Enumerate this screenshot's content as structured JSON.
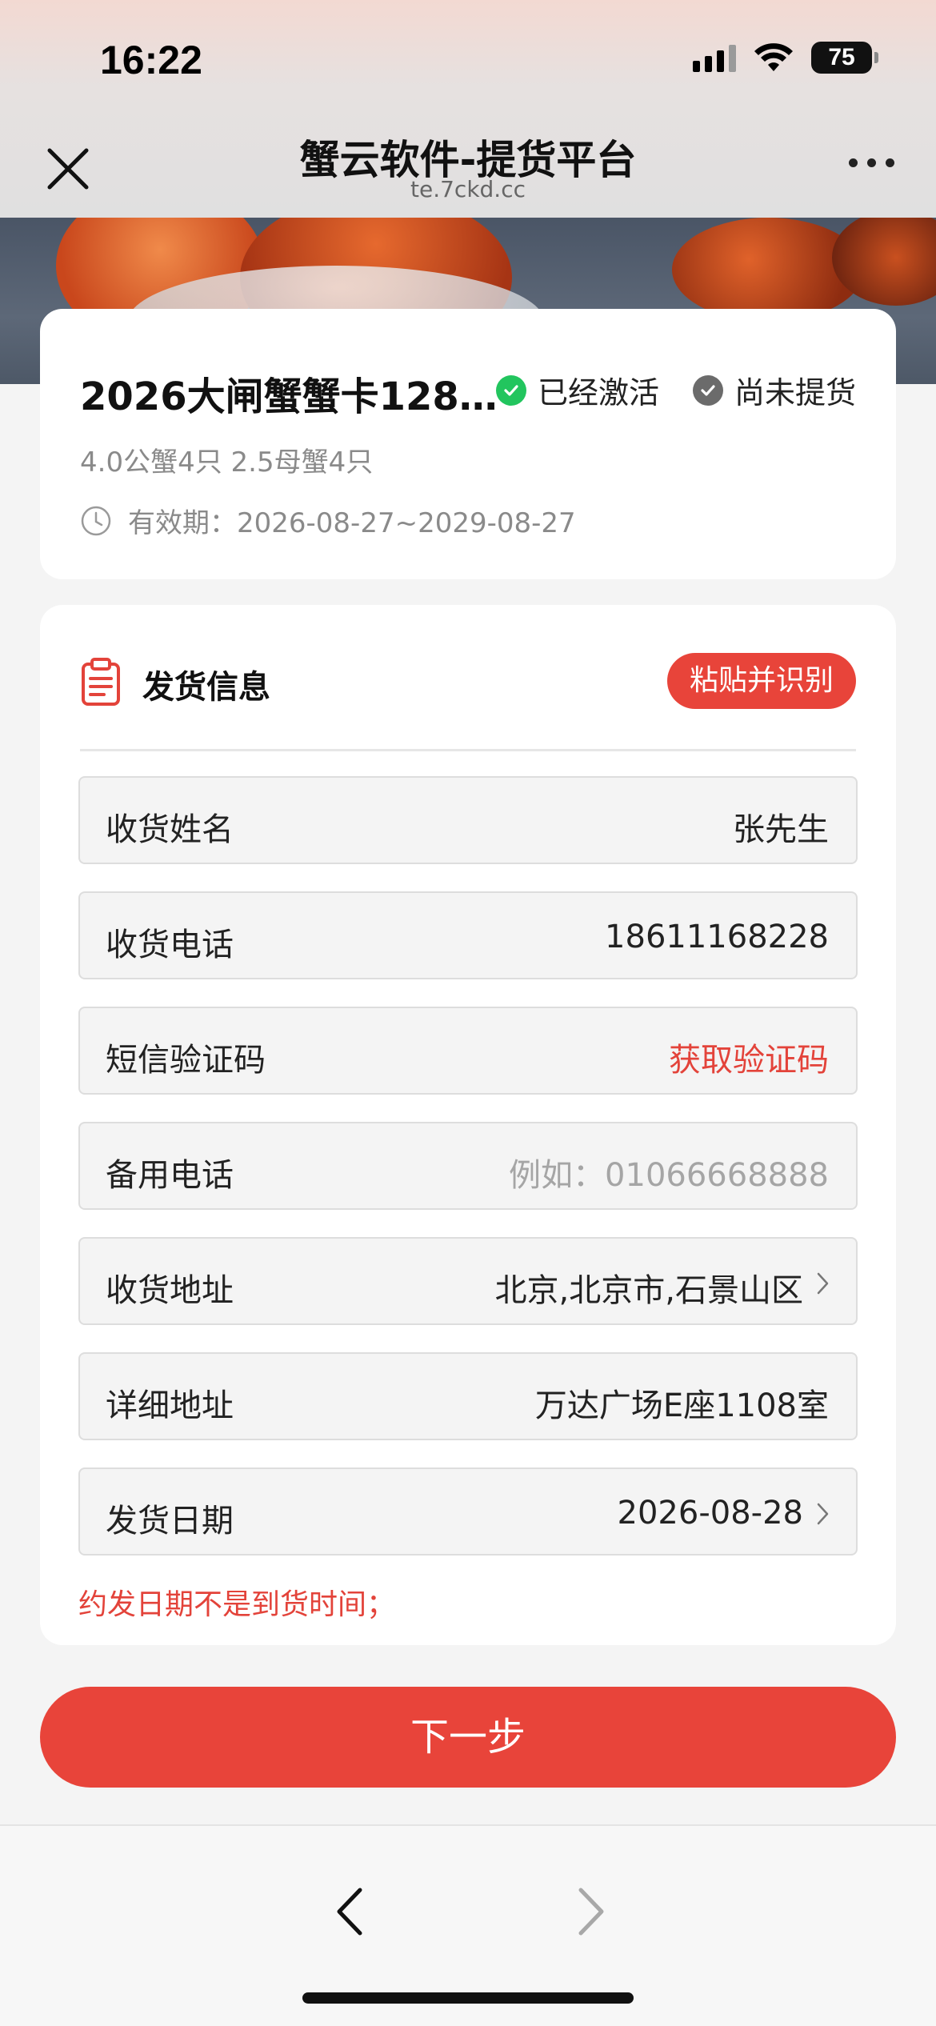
{
  "status_bar": {
    "time": "16:22",
    "battery": "75"
  },
  "nav": {
    "title": "蟹云软件-提货平台",
    "subtitle": "te.7ckd.cc"
  },
  "product": {
    "title": "2026大闸蟹蟹卡128…",
    "activated_label": "已经激活",
    "pickup_status_label": "尚未提货",
    "spec": "4.0公蟹4只 2.5母蟹4只",
    "validity": "有效期：2026-08-27~2029-08-27"
  },
  "delivery": {
    "section_title": "发货信息",
    "paste_button": "粘贴并识别",
    "fields": [
      {
        "label": "收货姓名",
        "value": "张先生"
      },
      {
        "label": "收货电话",
        "value": "18611168228"
      },
      {
        "label": "短信验证码",
        "action": "获取验证码"
      },
      {
        "label": "备用电话",
        "placeholder": "例如：01066668888"
      },
      {
        "label": "收货地址",
        "value": "北京,北京市,石景山区"
      },
      {
        "label": "详细地址",
        "value": "万达广场E座1108室"
      },
      {
        "label": "发货日期",
        "value": "2026-08-28"
      }
    ],
    "note": "约发日期不是到货时间；"
  },
  "next_button": "下一步",
  "colors": {
    "accent_red": "#e8443a",
    "active_green": "#22c55e",
    "pending_gray": "#6b6b6b"
  },
  "icons": [
    "close-icon",
    "more-icon",
    "check-icon",
    "clock-icon",
    "clipboard-icon",
    "chevron-right-icon",
    "back-arrow-icon",
    "forward-arrow-icon",
    "wifi-icon",
    "signal-icon",
    "battery-icon"
  ]
}
